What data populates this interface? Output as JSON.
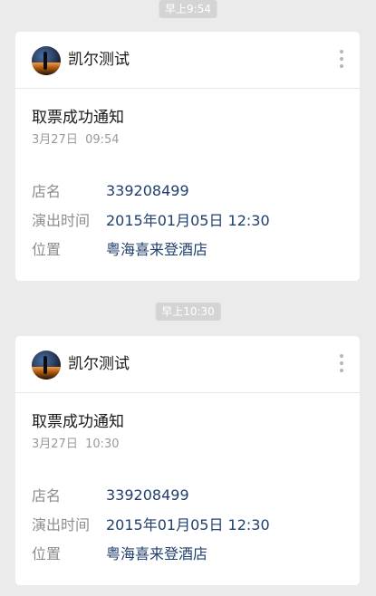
{
  "messages": [
    {
      "time_chip": "早上9:54",
      "sender": "凯尔测试",
      "title": "取票成功通知",
      "date": "3月27日",
      "time": "09:54",
      "fields": [
        {
          "label": "店名",
          "value": "339208499"
        },
        {
          "label": "演出时间",
          "value": "2015年01月05日 12:30"
        },
        {
          "label": "位置",
          "value": "粤海喜来登酒店"
        }
      ]
    },
    {
      "time_chip": "早上10:30",
      "sender": "凯尔测试",
      "title": "取票成功通知",
      "date": "3月27日",
      "time": "10:30",
      "fields": [
        {
          "label": "店名",
          "value": "339208499"
        },
        {
          "label": "演出时间",
          "value": "2015年01月05日 12:30"
        },
        {
          "label": "位置",
          "value": "粤海喜来登酒店"
        }
      ]
    }
  ],
  "icons": {
    "more": "more-vertical-icon",
    "avatar": "avatar-image"
  },
  "colors": {
    "background": "#ebebeb",
    "chip": "#d4d4d4",
    "value_text": "#1f3f6e",
    "label_text": "#8c8c8c"
  }
}
